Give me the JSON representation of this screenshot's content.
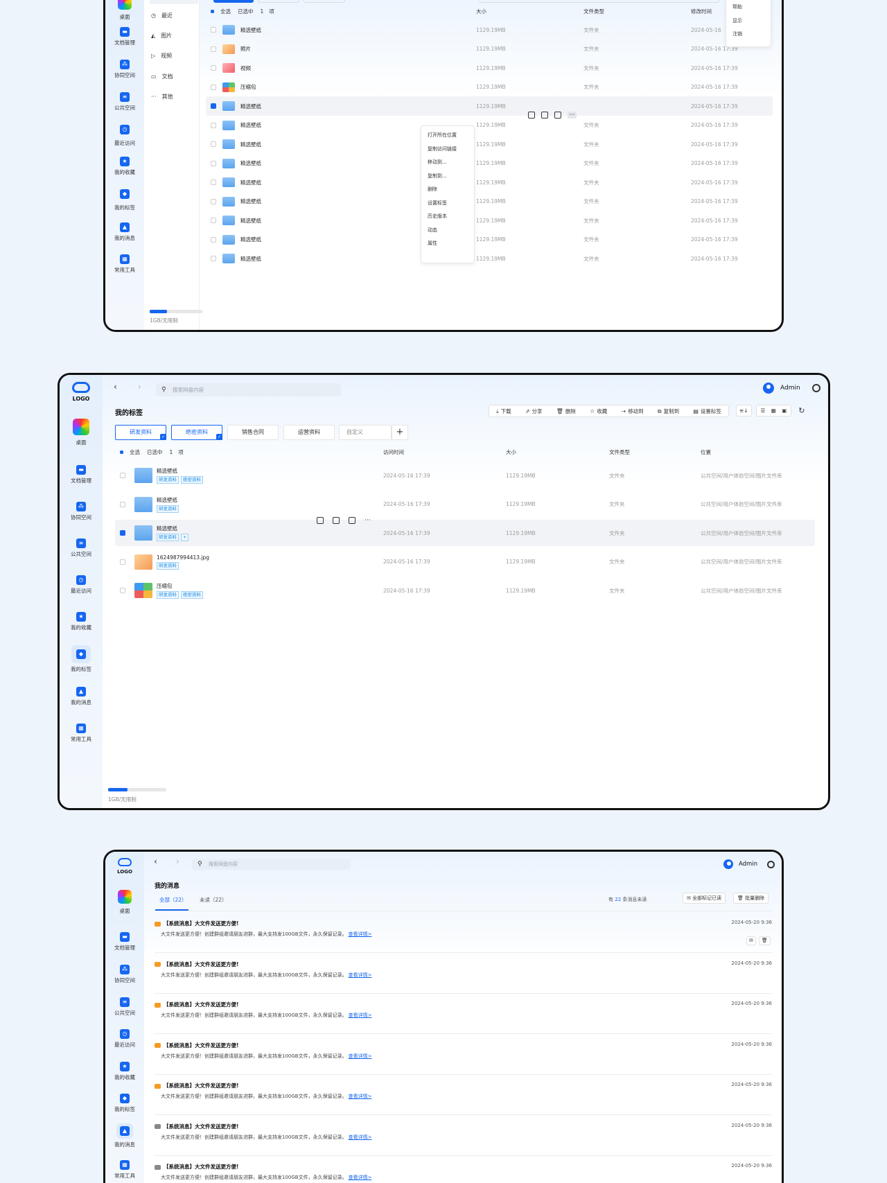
{
  "panel1": {
    "rail": [
      {
        "label": "桌面"
      },
      {
        "label": "文档管理"
      },
      {
        "label": "协同空间"
      },
      {
        "label": "公共空间"
      },
      {
        "label": "最近访问"
      },
      {
        "label": "我的收藏"
      },
      {
        "label": "我的标签"
      },
      {
        "label": "我的消息"
      },
      {
        "label": "常用工具"
      }
    ],
    "categories": [
      {
        "label": "最近",
        "icon": "clock-icon"
      },
      {
        "label": "图片",
        "icon": "image-icon"
      },
      {
        "label": "视频",
        "icon": "play-icon"
      },
      {
        "label": "文档",
        "icon": "document-icon"
      },
      {
        "label": "其他",
        "icon": "more-icon"
      }
    ],
    "storage": "1GB/无限制",
    "storage_fraction": 0.33,
    "header": {
      "select_all": "全选",
      "selected": "已选中",
      "count": "1",
      "unit": "项",
      "col_size": "大小",
      "col_type": "文件类型",
      "col_modified": "修改时间"
    },
    "rows": [
      {
        "name": "精选壁纸",
        "size": "1129.19MB",
        "type": "文件夹",
        "time": "2024-05-16",
        "thumb": "folder"
      },
      {
        "name": "照片",
        "size": "1129.19MB",
        "type": "文件夹",
        "time": "2024-05-16 17:39",
        "thumb": "image"
      },
      {
        "name": "视频",
        "size": "1129.19MB",
        "type": "文件夹",
        "time": "2024-05-16 17:39",
        "thumb": "wallpaper"
      },
      {
        "name": "压缩包",
        "size": "1129.19MB",
        "type": "文件夹",
        "time": "2024-05-16 17:39",
        "thumb": "zip"
      },
      {
        "name": "精选壁纸",
        "size": "1129.19MB",
        "type": "",
        "time": "2024-05-16 17:39",
        "thumb": "folder"
      },
      {
        "name": "精选壁纸",
        "size": "1129.19MB",
        "type": "文件夹",
        "time": "2024-05-16 17:39",
        "thumb": "folder"
      },
      {
        "name": "精选壁纸",
        "size": "1129.19MB",
        "type": "文件夹",
        "time": "2024-05-16 17:39",
        "thumb": "folder"
      },
      {
        "name": "精选壁纸",
        "size": "1129.19MB",
        "type": "文件夹",
        "time": "2024-05-16 17:39",
        "thumb": "folder"
      },
      {
        "name": "精选壁纸",
        "size": "1129.19MB",
        "type": "文件夹",
        "time": "2024-05-16 17:39",
        "thumb": "folder"
      },
      {
        "name": "精选壁纸",
        "size": "1129.19MB",
        "type": "文件夹",
        "time": "2024-05-16 17:39",
        "thumb": "folder"
      },
      {
        "name": "精选壁纸",
        "size": "1129.19MB",
        "type": "文件夹",
        "time": "2024-05-16 17:39",
        "thumb": "folder"
      },
      {
        "name": "精选壁纸",
        "size": "1129.19MB",
        "type": "文件夹",
        "time": "2024-05-16 17:39",
        "thumb": "folder"
      },
      {
        "name": "精选壁纸",
        "size": "1129.19MB",
        "type": "文件夹",
        "time": "2024-05-16 17:39",
        "thumb": "folder"
      }
    ],
    "context_menu": [
      "打开所在位置",
      "复制访问链接",
      "移动到...",
      "复制到...",
      "删除",
      "设置标签",
      "历史版本",
      "动态",
      "属性"
    ],
    "user_menu": [
      "帮助",
      "显示",
      "注销"
    ]
  },
  "panel2": {
    "logo": "LOGO",
    "rail": [
      {
        "label": "桌面"
      },
      {
        "label": "文档管理"
      },
      {
        "label": "协同空间"
      },
      {
        "label": "公共空间"
      },
      {
        "label": "最近访问"
      },
      {
        "label": "我的收藏"
      },
      {
        "label": "我的标签"
      },
      {
        "label": "我的消息"
      },
      {
        "label": "常用工具"
      }
    ],
    "search_placeholder": "搜索网盘内容",
    "user": "Admin",
    "page_title": "我的标签",
    "toolbar": [
      "下载",
      "分享",
      "删除",
      "收藏",
      "移动到",
      "复制到",
      "设置标签"
    ],
    "tags": [
      {
        "label": "研发资料",
        "selected": true
      },
      {
        "label": "绝密资料",
        "selected": true
      },
      {
        "label": "销售合同",
        "selected": false
      },
      {
        "label": "运营资料",
        "selected": false
      }
    ],
    "custom_placeholder": "自定义",
    "header": {
      "select_all": "全选",
      "selected": "已选中",
      "count": "1",
      "unit": "项",
      "col_access": "访问时间",
      "col_size": "大小",
      "col_type": "文件类型",
      "col_location": "位置"
    },
    "rows": [
      {
        "name": "精选壁纸",
        "tags": [
          "研发资料",
          "绝密资料"
        ],
        "time": "2024-05-16 17:39",
        "size": "1129.19MB",
        "type": "文件夹",
        "location": "公共空间/用户体验空间/图片文件库",
        "thumb": "folder"
      },
      {
        "name": "精选壁纸",
        "tags": [
          "研发资料"
        ],
        "time": "2024-05-16 17:39",
        "size": "1129.19MB",
        "type": "文件夹",
        "location": "公共空间/用户体验空间/图片文件库",
        "thumb": "folder"
      },
      {
        "name": "精选壁纸",
        "tags": [
          "研发资料"
        ],
        "time": "2024-05-16 17:39",
        "size": "1129.19MB",
        "type": "文件夹",
        "location": "公共空间/用户体验空间/图片文件库",
        "thumb": "folder"
      },
      {
        "name": "1624987994413.jpg",
        "tags": [
          "研发资料"
        ],
        "time": "2024-05-16 17:39",
        "size": "1129.19MB",
        "type": "文件夹",
        "location": "公共空间/用户体验空间/图片文件库",
        "thumb": "image"
      },
      {
        "name": "压缩包",
        "tags": [
          "研发资料",
          "绝密资料"
        ],
        "time": "2024-05-16 17:39",
        "size": "1129.19MB",
        "type": "文件夹",
        "location": "公共空间/用户体验空间/图片文件库",
        "thumb": "zip"
      }
    ],
    "storage": "1GB/无限制",
    "storage_fraction": 0.33
  },
  "panel3": {
    "logo": "LOGO",
    "rail": [
      {
        "label": "桌面"
      },
      {
        "label": "文档管理"
      },
      {
        "label": "协同空间"
      },
      {
        "label": "公共空间"
      },
      {
        "label": "最近访问"
      },
      {
        "label": "我的收藏"
      },
      {
        "label": "我的标签"
      },
      {
        "label": "我的消息"
      },
      {
        "label": "常用工具"
      }
    ],
    "search_placeholder": "搜索网盘内容",
    "user": "Admin",
    "page_title": "我的消息",
    "tab_all": "全部（22）",
    "tab_unread": "未读（22）",
    "unread_prefix": "有",
    "unread_count": "22",
    "unread_suffix": "条消息未读",
    "mark_all": "全部标记已读",
    "batch_delete": "批量删除",
    "messages": [
      {
        "title": "【系统消息】大文件发送更方便!",
        "body": "大文件发送更方便！创建群组邀请朋友进群，最大支持发100GB文件，永久保留记录。",
        "link": "查看详情>",
        "time": "2024-05-20 9:36",
        "read": false
      },
      {
        "title": "【系统消息】大文件发送更方便!",
        "body": "大文件发送更方便！创建群组邀请朋友进群，最大支持发100GB文件，永久保留记录。",
        "link": "查看详情>",
        "time": "2024-05-20 9:36",
        "read": false
      },
      {
        "title": "【系统消息】大文件发送更方便!",
        "body": "大文件发送更方便！创建群组邀请朋友进群，最大支持发100GB文件，永久保留记录。",
        "link": "查看详情>",
        "time": "2024-05-20 9:36",
        "read": false
      },
      {
        "title": "【系统消息】大文件发送更方便!",
        "body": "大文件发送更方便！创建群组邀请朋友进群，最大支持发100GB文件，永久保留记录。",
        "link": "查看详情>",
        "time": "2024-05-20 9:36",
        "read": false
      },
      {
        "title": "【系统消息】大文件发送更方便!",
        "body": "大文件发送更方便！创建群组邀请朋友进群，最大支持发100GB文件，永久保留记录。",
        "link": "查看详情>",
        "time": "2024-05-20 9:36",
        "read": false
      },
      {
        "title": "【系统消息】大文件发送更方便!",
        "body": "大文件发送更方便！创建群组邀请朋友进群，最大支持发100GB文件，永久保留记录。",
        "link": "查看详情>",
        "time": "2024-05-20 9:36",
        "read": true
      },
      {
        "title": "【系统消息】大文件发送更方便!",
        "body": "大文件发送更方便！创建群组邀请朋友进群，最大支持发100GB文件，永久保留记录。",
        "link": "查看详情>",
        "time": "2024-05-20 9:36",
        "read": true
      }
    ]
  }
}
